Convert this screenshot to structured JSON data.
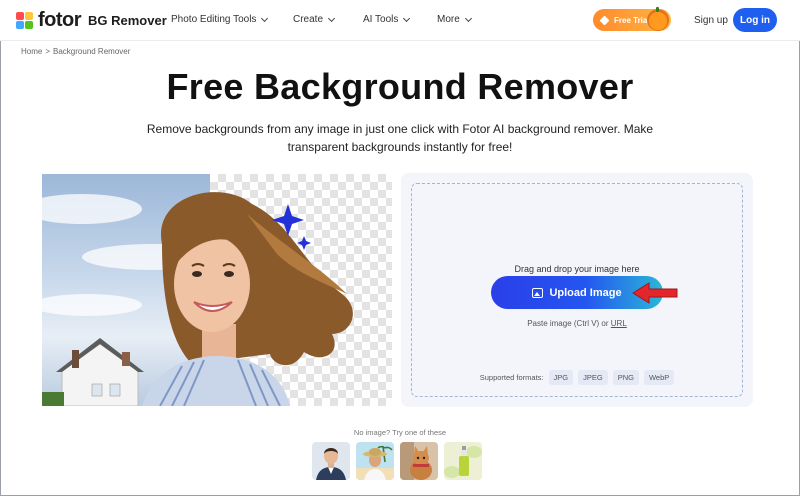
{
  "header": {
    "logo_text": "fotor",
    "product_name": "BG Remover",
    "nav": [
      {
        "label": "Photo Editing Tools"
      },
      {
        "label": "Create"
      },
      {
        "label": "AI Tools"
      },
      {
        "label": "More"
      }
    ],
    "free_trial_label": "Free Trial",
    "sign_up_label": "Sign up",
    "log_in_label": "Log in",
    "logo_colors": [
      "#ff4d4f",
      "#ffc53d",
      "#40a9ff",
      "#52c41a"
    ],
    "accent": "#1f5ff0"
  },
  "breadcrumb": {
    "home": "Home",
    "separator": ">",
    "current": "Background Remover"
  },
  "hero": {
    "title": "Free Background Remover",
    "subtitle": "Remove backgrounds from any image in just one click with Fotor AI background remover. Make transparent backgrounds instantly for free!"
  },
  "uploader": {
    "drag_text": "Drag and drop your image here",
    "upload_label": "Upload Image",
    "paste_text": "Paste image (Ctrl V) or",
    "url_label": "URL",
    "formats_label": "Supported formats:",
    "formats": [
      "JPG",
      "JPEG",
      "PNG",
      "WebP"
    ]
  },
  "samples": {
    "label": "No image? Try one of these",
    "items": [
      {
        "icon": "sample-man-in-suit"
      },
      {
        "icon": "sample-woman-in-hat"
      },
      {
        "icon": "sample-cat"
      },
      {
        "icon": "sample-product-bottle"
      }
    ]
  }
}
